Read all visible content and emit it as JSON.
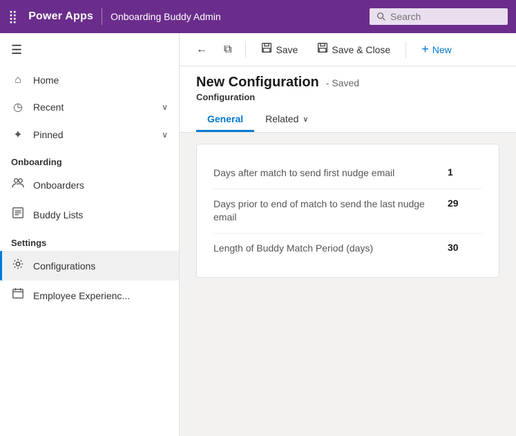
{
  "topbar": {
    "waffle_icon": "⣿",
    "app_name": "Power Apps",
    "app_title": "Onboarding Buddy Admin",
    "search_placeholder": "Search"
  },
  "toolbar": {
    "back_icon": "←",
    "expand_icon": "⧉",
    "save_label": "Save",
    "save_icon": "💾",
    "save_close_label": "Save & Close",
    "save_close_icon": "💾",
    "new_label": "New",
    "new_icon": "+"
  },
  "record": {
    "title": "New Configuration",
    "saved_status": "- Saved",
    "type": "Configuration"
  },
  "tabs": [
    {
      "id": "general",
      "label": "General",
      "active": true
    },
    {
      "id": "related",
      "label": "Related",
      "active": false
    }
  ],
  "sidebar": {
    "hamburger_icon": "☰",
    "nav_items": [
      {
        "id": "home",
        "icon": "⌂",
        "label": "Home"
      },
      {
        "id": "recent",
        "icon": "◷",
        "label": "Recent",
        "has_chevron": true
      },
      {
        "id": "pinned",
        "icon": "✦",
        "label": "Pinned",
        "has_chevron": true
      }
    ],
    "sections": [
      {
        "title": "Onboarding",
        "items": [
          {
            "id": "onboarders",
            "icon": "👤",
            "label": "Onboarders"
          },
          {
            "id": "buddy-lists",
            "icon": "📋",
            "label": "Buddy Lists"
          }
        ]
      },
      {
        "title": "Settings",
        "items": [
          {
            "id": "configurations",
            "icon": "⚙",
            "label": "Configurations",
            "active": true
          },
          {
            "id": "employee-experience",
            "icon": "📅",
            "label": "Employee Experienc..."
          }
        ]
      }
    ]
  },
  "form_fields": [
    {
      "label": "Days after match to send first nudge email",
      "value": "1"
    },
    {
      "label": "Days prior to end of match to send the last nudge email",
      "value": "29"
    },
    {
      "label": "Length of Buddy Match Period (days)",
      "value": "30"
    }
  ]
}
